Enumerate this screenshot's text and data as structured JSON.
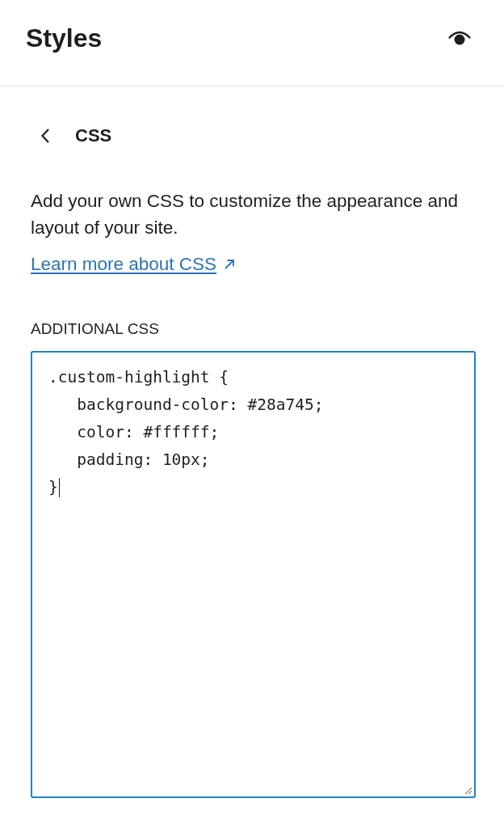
{
  "header": {
    "title": "Styles"
  },
  "panel": {
    "title": "CSS",
    "description": "Add your own CSS to customize the appearance and layout of your site.",
    "link": "Learn more about CSS"
  },
  "css_editor": {
    "label": "ADDITIONAL CSS",
    "value": ".custom-highlight {\n   background-color: #28a745;\n   color: #ffffff;\n   padding: 10px;\n}",
    "focused": true
  }
}
